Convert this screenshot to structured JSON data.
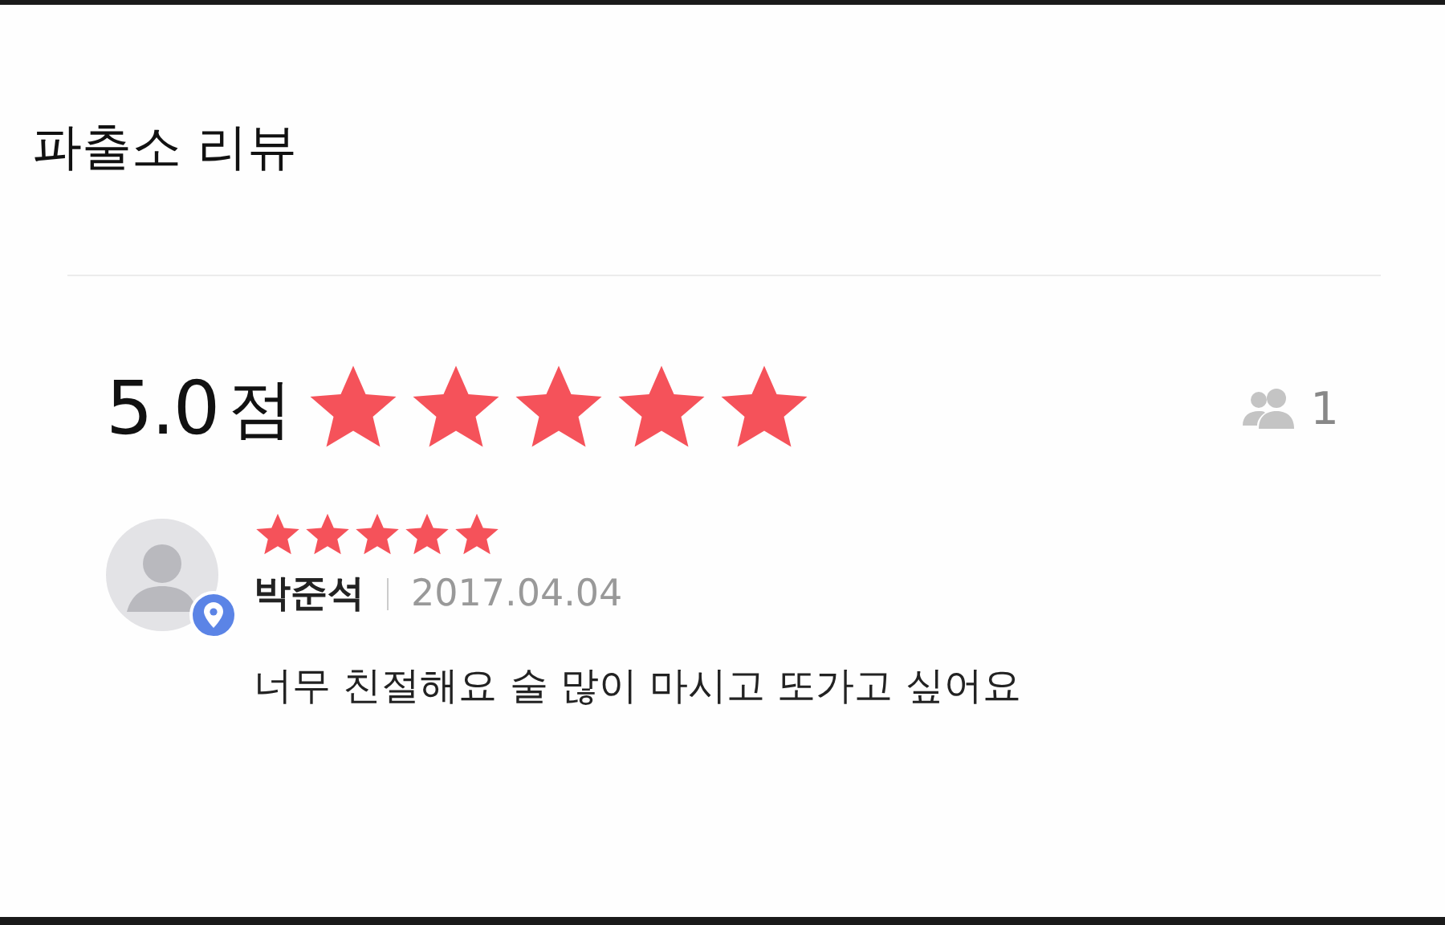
{
  "title": "파출소 리뷰",
  "summary": {
    "score": "5.0",
    "unit": "점",
    "stars": 5,
    "reviewer_count": "1"
  },
  "reviews": [
    {
      "name": "박준석",
      "date": "2017.04.04",
      "stars": 5,
      "text": "너무 친절해요 술 많이 마시고 또가고 싶어요"
    }
  ]
}
